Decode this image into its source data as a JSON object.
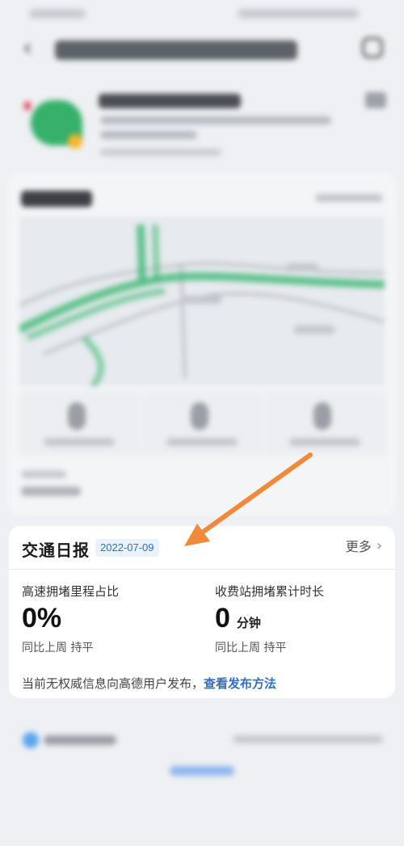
{
  "traffic_report": {
    "title": "交通日报",
    "date": "2022-07-09",
    "more_label": "更多",
    "metrics": [
      {
        "label": "高速拥堵里程占比",
        "value": "0%",
        "unit": "",
        "comparison": "同比上周 持平"
      },
      {
        "label": "收费站拥堵累计时长",
        "value": "0",
        "unit": "分钟",
        "comparison": "同比上周 持平"
      }
    ],
    "notice_text": "当前无权威信息向高德用户发布，",
    "notice_link": "查看发布方法"
  },
  "colors": {
    "accent_blue": "#2f6fc6",
    "arrow_orange": "#f08a3a",
    "map_green": "#3fb874"
  },
  "icons": {
    "back": "chevron-left-icon",
    "more_chevron": "chevron-right-icon",
    "annotation": "arrow-icon"
  }
}
